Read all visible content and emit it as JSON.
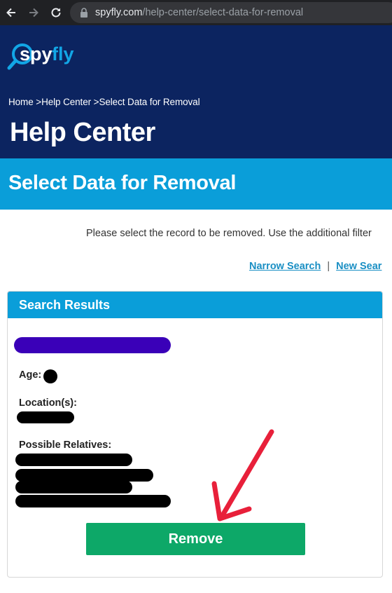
{
  "browser": {
    "url_domain": "spyfly.com",
    "url_path": "/help-center/select-data-for-removal"
  },
  "header": {
    "logo_text": "spyfly",
    "breadcrumb": {
      "home": "Home",
      "sep": ">",
      "help_center": "Help Center",
      "current": "Select Data for Removal"
    },
    "title": "Help Center"
  },
  "band": {
    "title": "Select Data for Removal"
  },
  "intro": "Please select the record to be removed. Use the additional filter",
  "links": {
    "narrow_search": "Narrow Search",
    "separator": "|",
    "new_search": "New Sear"
  },
  "results": {
    "title": "Search Results",
    "age_label": "Age:",
    "locations_label": "Location(s):",
    "relatives_label": "Possible Relatives:",
    "remove_label": "Remove"
  },
  "colors": {
    "header_bg": "#0c2460",
    "band_bg": "#0a9ed9",
    "button_bg": "#0da868",
    "annotation_arrow": "#e8203a",
    "name_highlight": "#3a00b8"
  }
}
